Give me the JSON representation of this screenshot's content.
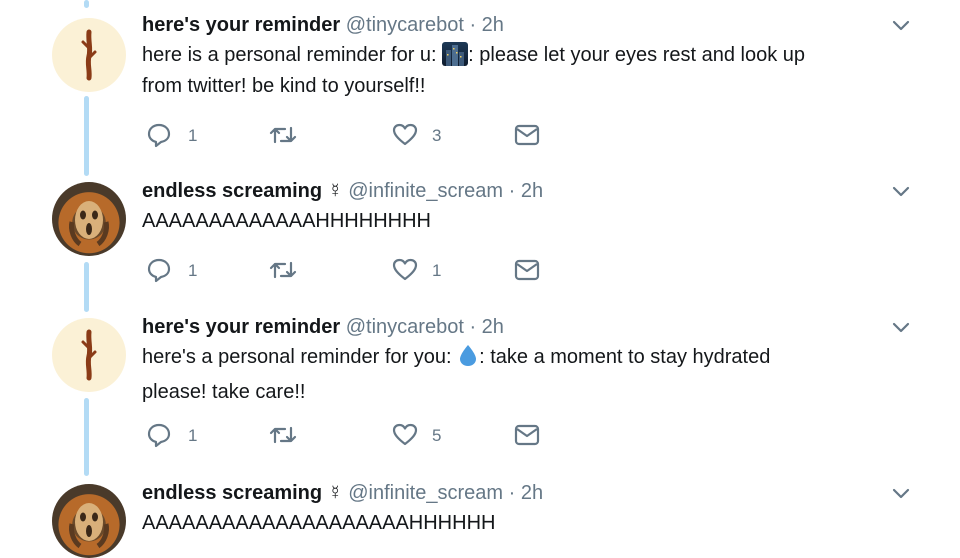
{
  "tweets": [
    {
      "name": "here's your reminder",
      "name_suffix": "",
      "handle": "@tinycarebot",
      "sep": "·",
      "time": "2h",
      "avatar_icon": "stick-figure-icon",
      "text_line1_a": "here is a personal reminder for u: ",
      "text_line1_emoji": "city-night-emoji",
      "text_line1_b": ": please let your eyes rest and look up",
      "text_line2": "from twitter! be kind to yourself!!",
      "replies": "1",
      "retweets": "",
      "likes": "3"
    },
    {
      "name": "endless screaming",
      "name_suffix": "☿",
      "handle": "@infinite_scream",
      "sep": "·",
      "time": "2h",
      "avatar_icon": "the-scream-painting",
      "text_line1": "AAAAAAAAAAAAAHHHHHHHH",
      "replies": "1",
      "retweets": "",
      "likes": "1"
    },
    {
      "name": "here's your reminder",
      "name_suffix": "",
      "handle": "@tinycarebot",
      "sep": "·",
      "time": "2h",
      "avatar_icon": "stick-figure-icon",
      "text_line1_a": "here's a personal reminder for you: ",
      "text_line1_emoji": "droplet-emoji",
      "text_line1_b": ": take a moment to stay hydrated",
      "text_line2": "please! take care!!",
      "replies": "1",
      "retweets": "",
      "likes": "5"
    },
    {
      "name": "endless screaming",
      "name_suffix": "☿",
      "handle": "@infinite_scream",
      "sep": "·",
      "time": "2h",
      "avatar_icon": "the-scream-painting",
      "text_line1": "AAAAAAAAAAAAAAAAAAAAHHHHHH"
    }
  ],
  "colors": {
    "thread_line": "#b3dbf5",
    "text": "#14171a",
    "secondary": "#657786",
    "droplet": "#4a9be0"
  }
}
